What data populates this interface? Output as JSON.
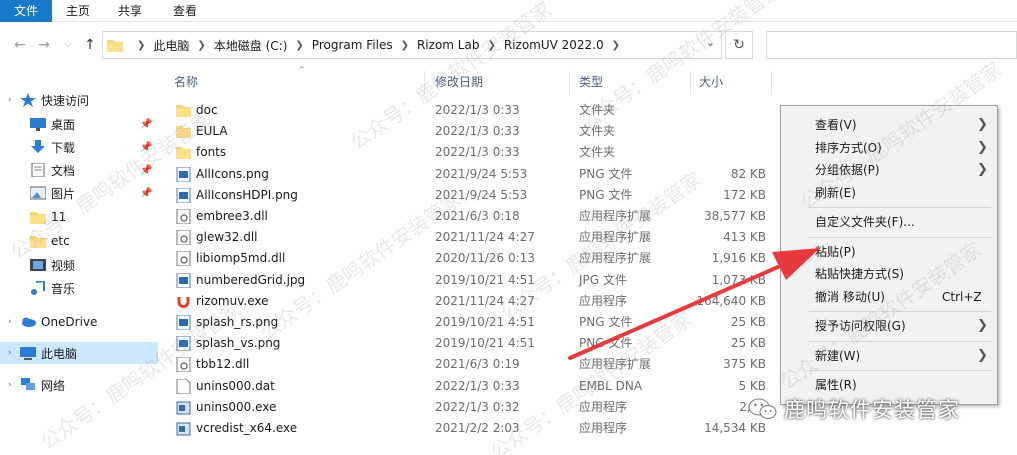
{
  "ribbon": {
    "file": "文件",
    "home": "主页",
    "share": "共享",
    "view": "查看"
  },
  "address": {
    "crumbs": [
      "此电脑",
      "本地磁盘 (C:)",
      "Program Files",
      "Rizom Lab",
      "RizomUV 2022.0"
    ]
  },
  "sidebar": {
    "items": [
      {
        "label": "快速访问",
        "icon": "star-icon"
      },
      {
        "label": "桌面",
        "icon": "desktop-icon",
        "pinned": true
      },
      {
        "label": "下载",
        "icon": "download-icon",
        "pinned": true
      },
      {
        "label": "文档",
        "icon": "document-icon",
        "pinned": true
      },
      {
        "label": "图片",
        "icon": "picture-icon",
        "pinned": true
      },
      {
        "label": "11",
        "icon": "folder-icon"
      },
      {
        "label": "etc",
        "icon": "folder-icon"
      },
      {
        "label": "视频",
        "icon": "video-icon"
      },
      {
        "label": "音乐",
        "icon": "music-icon"
      },
      {
        "label": "OneDrive",
        "icon": "cloud-icon"
      },
      {
        "label": "此电脑",
        "icon": "computer-icon",
        "selected": true
      },
      {
        "label": "网络",
        "icon": "network-icon"
      }
    ]
  },
  "columns": {
    "name": "名称",
    "date": "修改日期",
    "type": "类型",
    "size": "大小"
  },
  "files": [
    {
      "name": "doc",
      "date": "2022/1/3 0:33",
      "type": "文件夹",
      "size": "",
      "icon": "folder"
    },
    {
      "name": "EULA",
      "date": "2022/1/3 0:33",
      "type": "文件夹",
      "size": "",
      "icon": "folder"
    },
    {
      "name": "fonts",
      "date": "2022/1/3 0:33",
      "type": "文件夹",
      "size": "",
      "icon": "folder"
    },
    {
      "name": "AllIcons.png",
      "date": "2021/9/24 5:53",
      "type": "PNG 文件",
      "size": "82 KB",
      "icon": "image"
    },
    {
      "name": "AllIconsHDPI.png",
      "date": "2021/9/24 5:53",
      "type": "PNG 文件",
      "size": "172 KB",
      "icon": "image"
    },
    {
      "name": "embree3.dll",
      "date": "2021/6/3 0:18",
      "type": "应用程序扩展",
      "size": "38,577 KB",
      "icon": "dll"
    },
    {
      "name": "glew32.dll",
      "date": "2021/11/24 4:27",
      "type": "应用程序扩展",
      "size": "413 KB",
      "icon": "dll"
    },
    {
      "name": "libiomp5md.dll",
      "date": "2020/11/26 0:13",
      "type": "应用程序扩展",
      "size": "1,916 KB",
      "icon": "dll"
    },
    {
      "name": "numberedGrid.jpg",
      "date": "2019/10/21 4:51",
      "type": "JPG 文件",
      "size": "1,073 KB",
      "icon": "image"
    },
    {
      "name": "rizomuv.exe",
      "date": "2021/11/24 4:27",
      "type": "应用程序",
      "size": "164,640 KB",
      "icon": "rizom"
    },
    {
      "name": "splash_rs.png",
      "date": "2019/10/21 4:51",
      "type": "PNG 文件",
      "size": "25 KB",
      "icon": "image"
    },
    {
      "name": "splash_vs.png",
      "date": "2019/10/21 4:51",
      "type": "PNG 文件",
      "size": "25 KB",
      "icon": "image"
    },
    {
      "name": "tbb12.dll",
      "date": "2021/6/3 0:19",
      "type": "应用程序扩展",
      "size": "375 KB",
      "icon": "dll"
    },
    {
      "name": "unins000.dat",
      "date": "2022/1/3 0:33",
      "type": "EMBL DNA",
      "size": "5 KB",
      "icon": "file"
    },
    {
      "name": "unins000.exe",
      "date": "2022/1/3 0:32",
      "type": "应用程序",
      "size": "2,49",
      "icon": "installer"
    },
    {
      "name": "vcredist_x64.exe",
      "date": "2021/2/2 2:03",
      "type": "应用程序",
      "size": "14,534 KB",
      "icon": "installer"
    }
  ],
  "context_menu": {
    "items": [
      {
        "label": "查看(V)",
        "submenu": true
      },
      {
        "label": "排序方式(O)",
        "submenu": true
      },
      {
        "label": "分组依据(P)",
        "submenu": true
      },
      {
        "label": "刷新(E)"
      },
      {
        "separator": true
      },
      {
        "label": "自定义文件夹(F)..."
      },
      {
        "separator": true
      },
      {
        "label": "粘贴(P)"
      },
      {
        "label": "粘贴快捷方式(S)"
      },
      {
        "label": "撤消 移动(U)",
        "shortcut": "Ctrl+Z"
      },
      {
        "separator": true
      },
      {
        "label": "授予访问权限(G)",
        "submenu": true
      },
      {
        "separator": true
      },
      {
        "label": "新建(W)",
        "submenu": true
      },
      {
        "separator": true
      },
      {
        "label": "属性(R)"
      }
    ]
  },
  "watermark": {
    "text": "公众号：鹿鸣软件安装管家",
    "brand": "鹿鸣软件安装管家"
  },
  "colors": {
    "accent": "#1979ca",
    "selection": "#cce8ff",
    "folder": "#f8d775",
    "arrow": "#e8393d"
  }
}
